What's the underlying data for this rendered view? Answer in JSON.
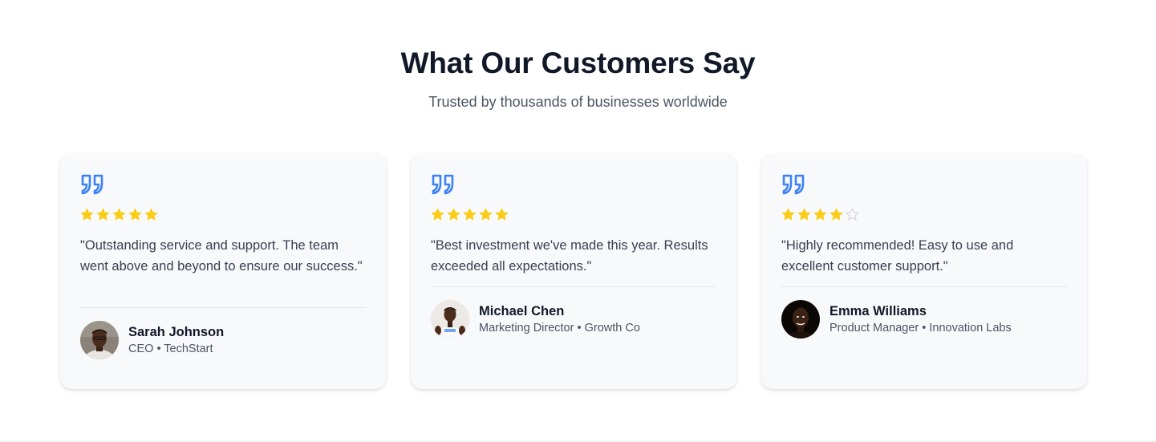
{
  "header": {
    "title": "What Our Customers Say",
    "subtitle": "Trusted by thousands of businesses worldwide"
  },
  "colors": {
    "accent": "#3b82f6",
    "star_filled": "#facc15",
    "star_empty": "#d1d5db"
  },
  "testimonials": [
    {
      "quote": "\"Outstanding service and support. The team went above and beyond to ensure our success.\"",
      "rating": 5,
      "name": "Sarah Johnson",
      "role": "CEO • TechStart",
      "avatar_icon": "person-avatar"
    },
    {
      "quote": "\"Best investment we've made this year. Results exceeded all expectations.\"",
      "rating": 5,
      "name": "Michael Chen",
      "role": "Marketing Director • Growth Co",
      "avatar_icon": "person-avatar"
    },
    {
      "quote": "\"Highly recommended! Easy to use and excellent customer support.\"",
      "rating": 4,
      "name": "Emma Williams",
      "role": "Product Manager • Innovation Labs",
      "avatar_icon": "person-avatar"
    }
  ]
}
